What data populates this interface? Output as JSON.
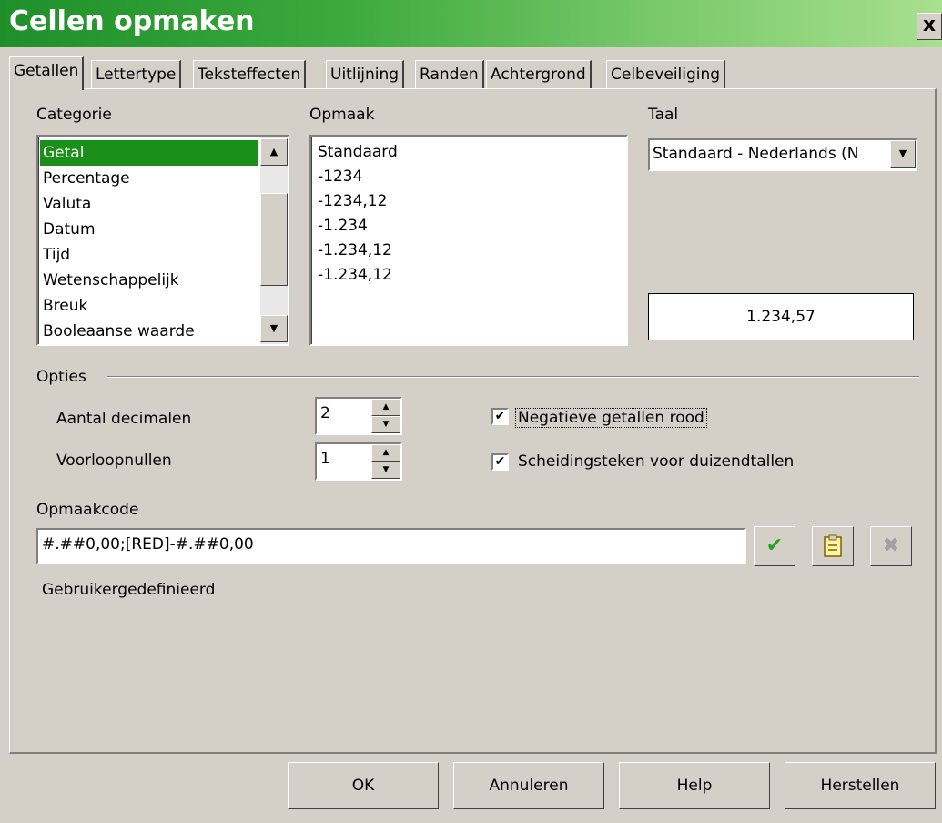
{
  "window": {
    "title": "Cellen opmaken",
    "close_glyph": "x"
  },
  "tabs": [
    {
      "label": "Getallen"
    },
    {
      "label": "Lettertype"
    },
    {
      "label": "Teksteffecten"
    },
    {
      "label": "Uitlijning"
    },
    {
      "label": "Randen"
    },
    {
      "label": "Achtergrond"
    },
    {
      "label": "Celbeveiliging"
    }
  ],
  "categorie": {
    "label": "Categorie",
    "items": [
      "Getal",
      "Percentage",
      "Valuta",
      "Datum",
      "Tijd",
      "Wetenschappelijk",
      "Breuk",
      "Booleaanse waarde"
    ],
    "selected": "Getal"
  },
  "opmaak": {
    "label": "Opmaak",
    "items": [
      "Standaard",
      "-1234",
      "-1234,12",
      "-1.234",
      "-1.234,12",
      "-1.234,12"
    ]
  },
  "taal": {
    "label": "Taal",
    "value": "Standaard - Nederlands (N"
  },
  "preview": {
    "value": "1.234,57"
  },
  "opties": {
    "label": "Opties",
    "decimalen_label": "Aantal decimalen",
    "decimalen_value": "2",
    "voorloopnullen_label": "Voorloopnullen",
    "voorloopnullen_value": "1",
    "negatief_rood_label": "Negatieve getallen rood",
    "negatief_rood_checked": true,
    "duizendtallen_label": "Scheidingsteken voor duizendtallen",
    "duizendtallen_checked": true
  },
  "opmaakcode": {
    "label": "Opmaakcode",
    "value": "#.##0,00;[RED]-#.##0,00",
    "comment": "Gebruikergedefinieerd"
  },
  "buttons": {
    "ok": "OK",
    "annuleren": "Annuleren",
    "help": "Help",
    "herstellen": "Herstellen"
  },
  "colors": {
    "title_start": "#1f8f2a",
    "title_end": "#a8e08f",
    "selection": "#1a8f1a",
    "check_green": "#2aa02a"
  },
  "icons": {
    "accept": "check-icon",
    "comment": "note-icon",
    "delete": "x-icon"
  }
}
